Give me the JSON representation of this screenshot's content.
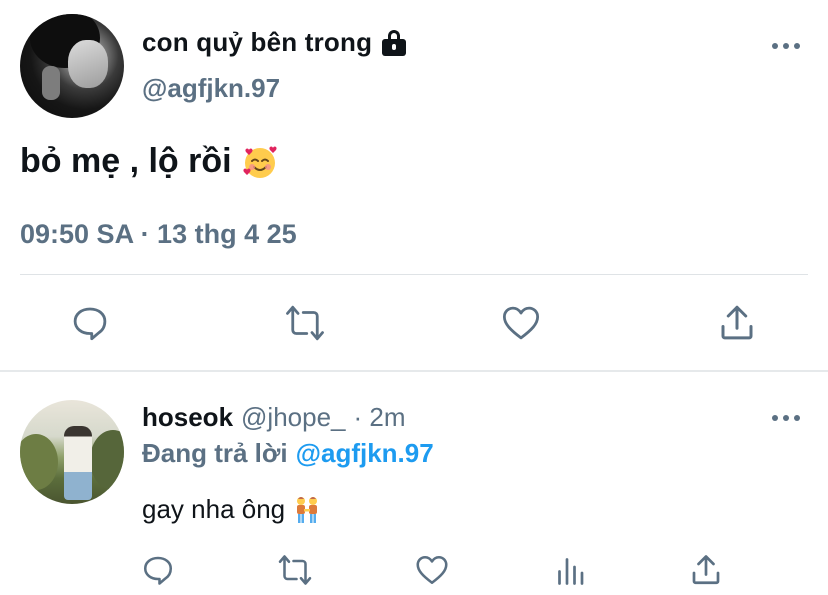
{
  "tweet": {
    "author_name": "con quỷ bên trong",
    "author_handle": "@agfjkn.97",
    "text": "bỏ mẹ , lộ rồi",
    "timestamp": "09:50 SA · 13 thg 4 25",
    "icons": {
      "verified": "lock-icon",
      "more": "more-icon",
      "emoji": "smiling-face-with-hearts-emoji",
      "reply": "reply-icon",
      "retweet": "retweet-icon",
      "like": "like-icon",
      "share": "share-icon"
    }
  },
  "reply": {
    "author_name": "hoseok",
    "author_handle": "@jhope_",
    "time": "· 2m",
    "replying_label": "Đang trả lời",
    "replying_to": "@agfjkn.97",
    "text": "gay nha ông",
    "icons": {
      "more": "more-icon",
      "emoji": "two-men-holding-hands-emoji",
      "reply": "reply-icon",
      "retweet": "retweet-icon",
      "like": "like-icon",
      "analytics": "analytics-icon",
      "share": "share-icon"
    }
  },
  "colors": {
    "text": "#0f1419",
    "secondary": "#5b7083",
    "link": "#1d9bf0",
    "divider": "#dfe3e6"
  }
}
